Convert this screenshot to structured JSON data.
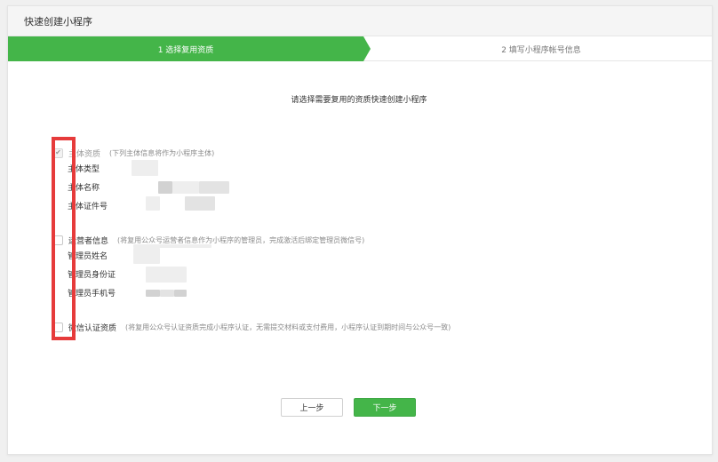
{
  "dialog": {
    "title": "快速创建小程序"
  },
  "steps": [
    {
      "label": "1 选择复用资质",
      "active": true
    },
    {
      "label": "2 填写小程序帐号信息",
      "active": false
    }
  ],
  "intro": "请选择需要复用的资质快速创建小程序",
  "sections": [
    {
      "title": "主体资质",
      "description": "(下列主体信息将作为小程序主体)",
      "checked": true,
      "disabled": true,
      "fields": [
        "主体类型",
        "主体名称",
        "主体证件号"
      ]
    },
    {
      "title": "运营者信息",
      "description": "(将复用公众号运营者信息作为小程序的管理员，完成激活后绑定管理员微信号)",
      "checked": false,
      "disabled": false,
      "fields": [
        "管理员姓名",
        "管理员身份证",
        "管理员手机号"
      ]
    },
    {
      "title": "微信认证资质",
      "description": "(将复用公众号认证资质完成小程序认证，无需提交材料或支付费用，小程序认证到期时间与公众号一致)",
      "checked": false,
      "disabled": false,
      "fields": []
    }
  ],
  "icons": {
    "check": "✔"
  },
  "buttons": {
    "prev": "上一步",
    "next": "下一步"
  },
  "colors": {
    "primary": "#44b549",
    "highlight": "#e63b3b"
  }
}
